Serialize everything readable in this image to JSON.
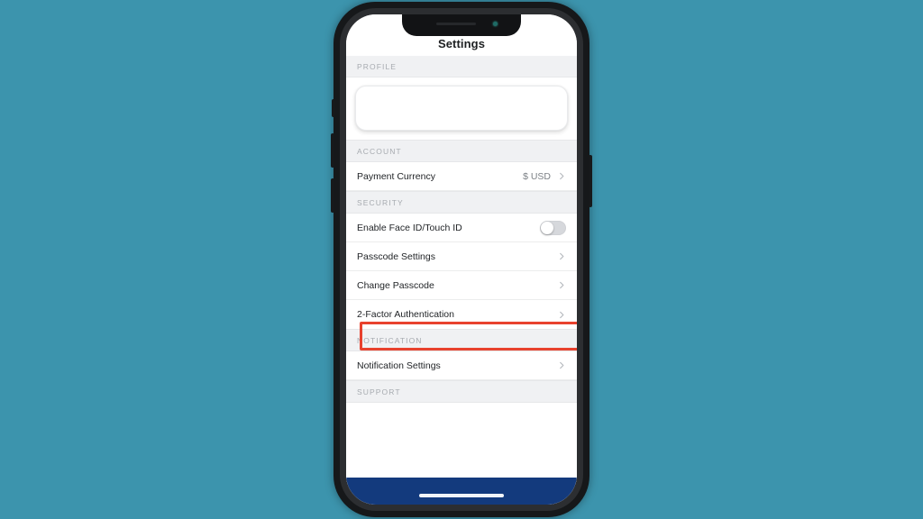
{
  "background": {
    "color": "#3c94ad"
  },
  "device": {
    "frame_color": "#16181a",
    "buttons": [
      "mute-switch",
      "volume-up",
      "volume-down",
      "power"
    ],
    "notch": {
      "speaker": "speaker-grille",
      "camera": "front-camera"
    }
  },
  "screen": {
    "navbar": {
      "title": "Settings"
    },
    "sections": [
      {
        "header": "PROFILE",
        "type": "card",
        "card_content": ""
      },
      {
        "header": "ACCOUNT",
        "type": "rows",
        "rows": [
          {
            "label": "Payment Currency",
            "value": "$ USD",
            "accessory": "chevron-right-icon"
          }
        ]
      },
      {
        "header": "SECURITY",
        "type": "rows",
        "rows": [
          {
            "label": "Enable Face ID/Touch ID",
            "value": "",
            "accessory": "toggle-switch",
            "toggle_state": "off"
          },
          {
            "label": "Passcode Settings",
            "value": "",
            "accessory": "chevron-right-icon"
          },
          {
            "label": "Change Passcode",
            "value": "",
            "accessory": "chevron-right-icon"
          },
          {
            "label": "2-Factor Authentication",
            "value": "",
            "accessory": "chevron-right-icon",
            "highlighted": true
          }
        ]
      },
      {
        "header": "NOTIFICATION",
        "type": "rows",
        "rows": [
          {
            "label": "Notification Settings",
            "value": "",
            "accessory": "chevron-right-icon"
          }
        ]
      },
      {
        "header": "SUPPORT",
        "type": "rows",
        "rows": []
      }
    ],
    "highlight": {
      "target": "2-Factor Authentication",
      "color": "#e8422e"
    },
    "home_bar": {
      "color": "#133a7d",
      "indicator_color": "#f2f5fa"
    }
  }
}
